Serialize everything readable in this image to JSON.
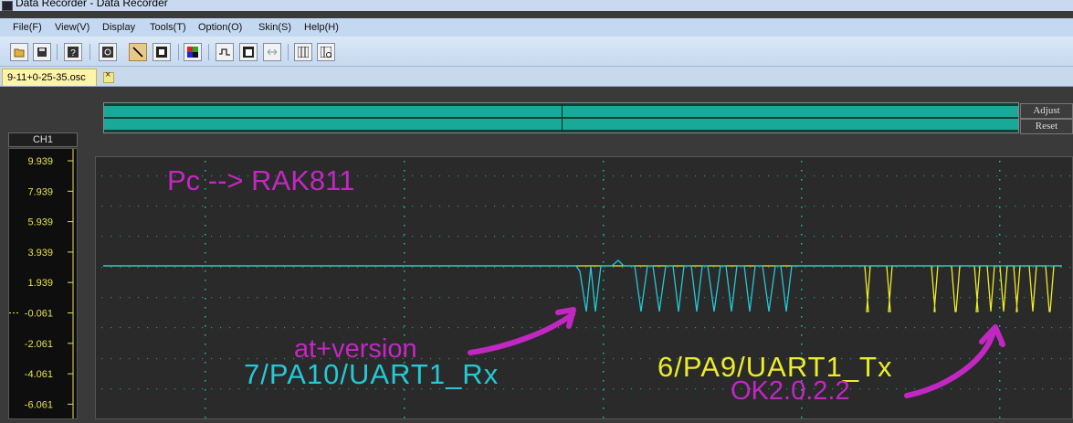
{
  "window": {
    "title": "Data Recorder - Data Recorder"
  },
  "menu": [
    "File(F)",
    "View(V)",
    "Display",
    "Tools(T)",
    "Option(O)",
    "Skin(S)",
    "Help(H)"
  ],
  "toolbar": [
    {
      "name": "open-file-icon",
      "active": false
    },
    {
      "name": "save-icon",
      "active": false
    },
    {
      "name": "help-icon",
      "active": false
    },
    {
      "name": "settings-icon",
      "active": false
    },
    {
      "name": "draw-line-icon",
      "active": true
    },
    {
      "name": "stop-icon",
      "active": false
    },
    {
      "name": "color-icon",
      "active": false
    },
    {
      "name": "waveform-icon",
      "active": false
    },
    {
      "name": "copy-icon",
      "active": false
    },
    {
      "name": "fit-icon",
      "active": false
    },
    {
      "name": "columns-icon",
      "active": false
    },
    {
      "name": "columns-add-icon",
      "active": false
    }
  ],
  "file_tab": {
    "label": "9-11+0-25-35.osc"
  },
  "controls": {
    "adjust": "Adjust",
    "reset": "Reset"
  },
  "channel": {
    "label": "CH1",
    "ticks": [
      "9.939",
      "7.939",
      "5.939",
      "3.939",
      "1.939",
      "-0.061",
      "-2.061",
      "-4.061",
      "-6.061"
    ]
  },
  "annotations": {
    "heading": "Pc --> RAK811",
    "command": "at+version",
    "rx_pin": "7/PA10/UART1_Rx",
    "tx_pin": "6/PA9/UART1_Tx",
    "response": "OK2.0.2.2"
  },
  "colors": {
    "grid": "#16c3a8",
    "rx": "#23c9d6",
    "tx": "#ecec2a",
    "annotation": "#c327c3",
    "scope_bg": "#2a2a2a"
  }
}
